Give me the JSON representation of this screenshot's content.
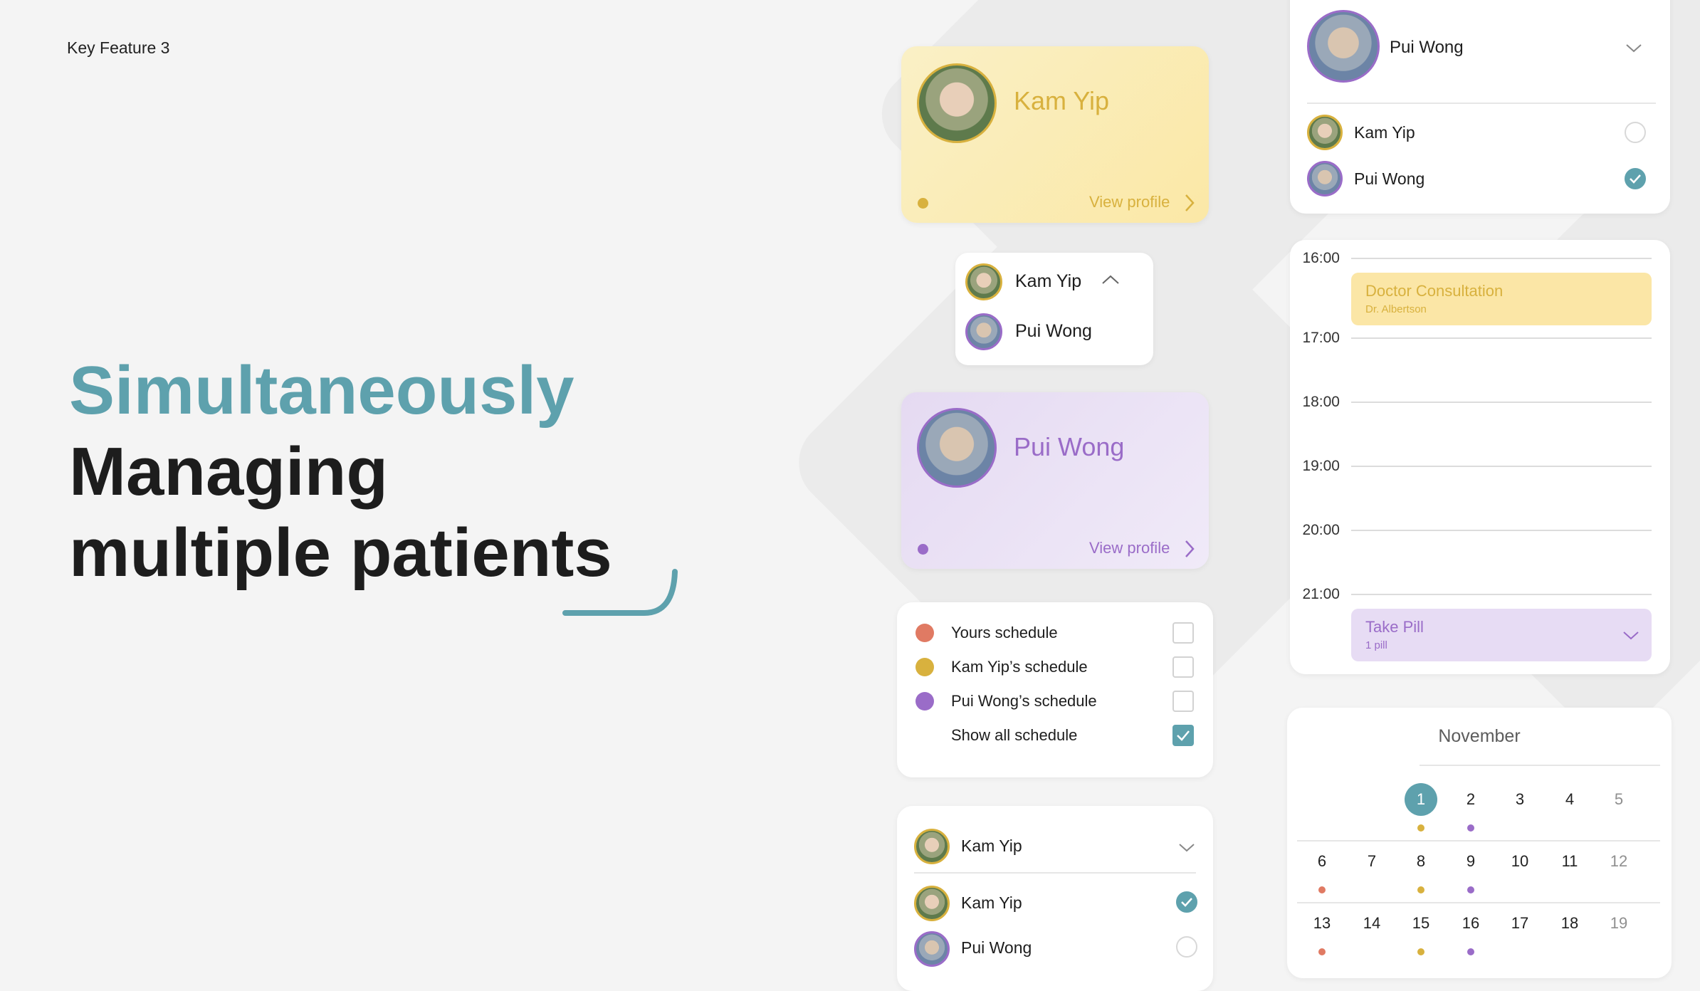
{
  "header": {
    "kicker": "Key Feature 3"
  },
  "hero": {
    "line1": "Simultaneously",
    "line2": "Managing",
    "line3": "multiple patients"
  },
  "colors": {
    "accent_teal": "#5ea1ad",
    "yellow": "#d8b13e",
    "purple": "#9a6cc8",
    "coral": "#e07a63"
  },
  "profile_cards": [
    {
      "name": "Kam Yip",
      "link": "View profile",
      "icon": "chevron-right-icon"
    },
    {
      "name": "Pui Wong",
      "link": "View profile",
      "icon": "chevron-right-icon"
    }
  ],
  "switcher": {
    "items": [
      "Kam Yip",
      "Pui Wong"
    ],
    "icon": "chevron-up-icon"
  },
  "schedule_filter": {
    "items": [
      {
        "label": "Yours schedule",
        "color": "#e07a63",
        "checked": false
      },
      {
        "label": "Kam Yip’s schedule",
        "color": "#d8b13e",
        "checked": false
      },
      {
        "label": "Pui Wong’s schedule",
        "color": "#9a6cc8",
        "checked": false
      },
      {
        "label": "Show all schedule",
        "checked": true
      }
    ]
  },
  "select_bottom": {
    "selected": "Kam Yip",
    "options": [
      {
        "name": "Kam Yip",
        "checked": true
      },
      {
        "name": "Pui Wong",
        "checked": false
      }
    ]
  },
  "select_top": {
    "selected": "Pui Wong",
    "options": [
      {
        "name": "Kam Yip",
        "checked": false
      },
      {
        "name": "Pui Wong",
        "checked": true
      }
    ]
  },
  "timeline": {
    "times": [
      "16:00",
      "17:00",
      "18:00",
      "19:00",
      "20:00",
      "21:00"
    ],
    "events": [
      {
        "title": "Doctor Consultation",
        "subtitle": "Dr. Albertson"
      },
      {
        "title": "Take Pill",
        "subtitle": "1 pill"
      }
    ]
  },
  "calendar": {
    "month": "November",
    "selected_day": 1,
    "weeks": [
      [
        "",
        "",
        "1",
        "2",
        "3",
        "4",
        "5"
      ],
      [
        "6",
        "7",
        "8",
        "9",
        "10",
        "11",
        "12"
      ],
      [
        "13",
        "14",
        "15",
        "16",
        "17",
        "18",
        "19"
      ]
    ],
    "event_dots": {
      "1": "#d8b13e",
      "2": "#9a6cc8",
      "6": "#e07a63",
      "8": "#d8b13e",
      "9": "#9a6cc8",
      "13": "#e07a63",
      "15": "#d8b13e",
      "16": "#9a6cc8"
    }
  }
}
